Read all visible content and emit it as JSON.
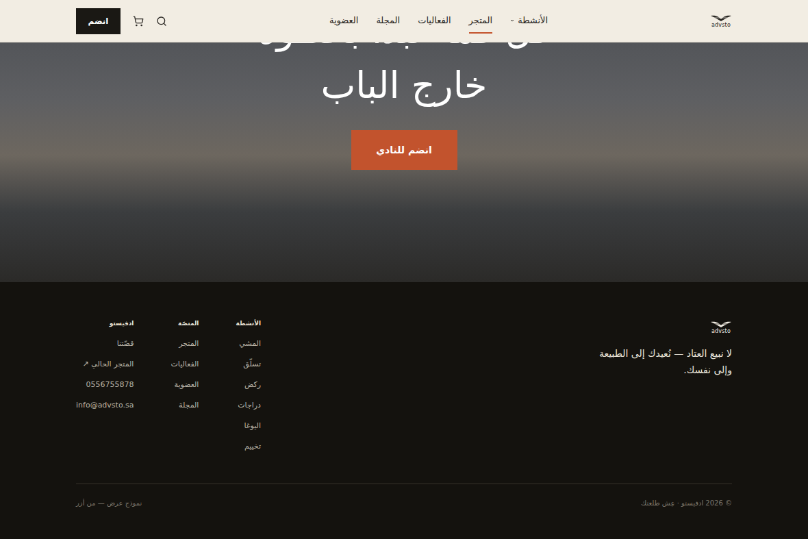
{
  "header": {
    "logo": "advsto",
    "nav": [
      {
        "label": "الأنشطة",
        "selected": false,
        "dropdown": true
      },
      {
        "label": "المتجر",
        "selected": true,
        "dropdown": false
      },
      {
        "label": "الفعاليات",
        "selected": false,
        "dropdown": false
      },
      {
        "label": "المجلة",
        "selected": false,
        "dropdown": false
      },
      {
        "label": "العضوية",
        "selected": false,
        "dropdown": false
      }
    ],
    "join_button": "انضم"
  },
  "hero": {
    "headline": [
      "كل قمة تبدأ بخطوة",
      "خارج الباب"
    ],
    "cta": "انضم للنادي"
  },
  "footer": {
    "logo": "advsto",
    "tagline": "لا نبيع العتاد — نُعيدك إلى الطبيعة وإلى نفسك.",
    "columns": [
      {
        "title": "الأنشطة",
        "links": [
          "المشي",
          "تسلّق",
          "ركض",
          "دراجات",
          "اليوغا",
          "تخييم"
        ]
      },
      {
        "title": "المنصّة",
        "links": [
          "المتجر",
          "الفعاليات",
          "العضوية",
          "المجلة"
        ]
      },
      {
        "title": "ادفيستو",
        "links": [
          "قصّتنا",
          "المتجر الحالي ↗",
          "0556755878",
          "info@advsto.sa"
        ]
      }
    ],
    "copyright": "© 2026 ادفيستو · عِش طلعتك",
    "note": "نموذج عرض — من أزر"
  }
}
